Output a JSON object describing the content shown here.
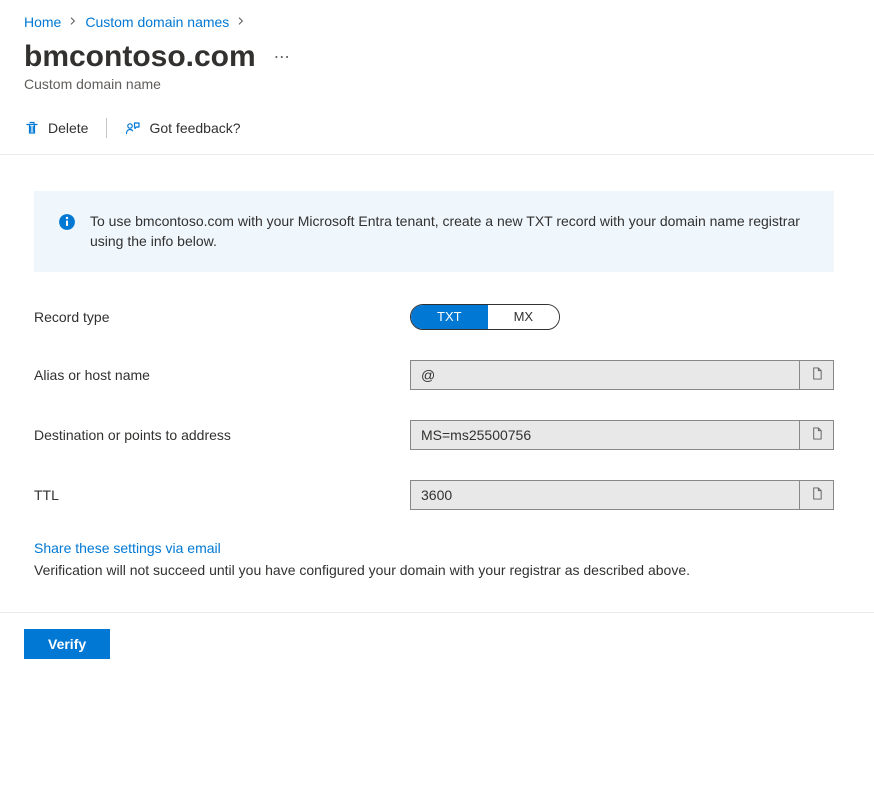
{
  "breadcrumb": {
    "home": "Home",
    "custom_domains": "Custom domain names"
  },
  "title": "bmcontoso.com",
  "subtitle": "Custom domain name",
  "toolbar": {
    "delete_label": "Delete",
    "feedback_label": "Got feedback?"
  },
  "info_text": "To use bmcontoso.com with your Microsoft Entra tenant, create a new TXT record with your domain name registrar using the info below.",
  "form": {
    "record_type_label": "Record type",
    "record_type_options": {
      "txt": "TXT",
      "mx": "MX"
    },
    "alias_label": "Alias or host name",
    "alias_value": "@",
    "destination_label": "Destination or points to address",
    "destination_value": "MS=ms25500756",
    "ttl_label": "TTL",
    "ttl_value": "3600"
  },
  "share_link": "Share these settings via email",
  "note": "Verification will not succeed until you have configured your domain with your registrar as described above.",
  "verify_label": "Verify"
}
